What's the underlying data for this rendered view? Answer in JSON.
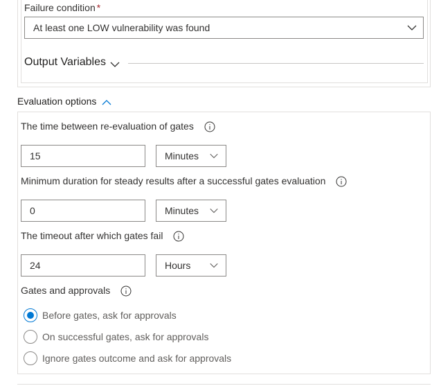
{
  "gate": {
    "failure_condition_label": "Failure condition",
    "required_marker": "*",
    "failure_condition_value": "At least one LOW vulnerability was found",
    "output_variables_label": "Output Variables"
  },
  "evaluation": {
    "section_label": "Evaluation options",
    "reevaluation": {
      "label": "The time between re-evaluation of gates",
      "value": "15",
      "unit": "Minutes"
    },
    "steady": {
      "label": "Minimum duration for steady results after a successful gates evaluation",
      "value": "0",
      "unit": "Minutes"
    },
    "timeout": {
      "label": "The timeout after which gates fail",
      "value": "24",
      "unit": "Hours"
    },
    "approvals": {
      "label": "Gates and approvals",
      "options": [
        {
          "label": "Before gates, ask for approvals",
          "selected": true
        },
        {
          "label": "On successful gates, ask for approvals",
          "selected": false
        },
        {
          "label": "Ignore gates outcome and ask for approvals",
          "selected": false
        }
      ]
    }
  },
  "colors": {
    "accent": "#0078d4",
    "border": "#e1dfdd",
    "input_border": "#8a8886",
    "required": "#a4262c"
  }
}
